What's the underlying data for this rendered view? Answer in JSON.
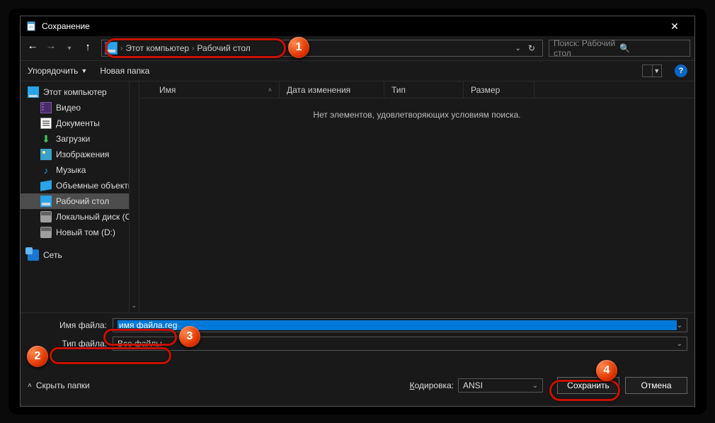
{
  "window": {
    "title": "Сохранение"
  },
  "nav": {
    "breadcrumb": [
      "Этот компьютер",
      "Рабочий стол"
    ],
    "search_placeholder": "Поиск: Рабочий стол"
  },
  "toolbar": {
    "organize": "Упорядочить",
    "new_folder": "Новая папка"
  },
  "columns": {
    "name": "Имя",
    "date": "Дата изменения",
    "type": "Тип",
    "size": "Размер"
  },
  "empty_text": "Нет элементов, удовлетворяющих условиям поиска.",
  "tree": {
    "this_pc": "Этот компьютер",
    "items": [
      {
        "icon": "video",
        "label": "Видео"
      },
      {
        "icon": "doc",
        "label": "Документы"
      },
      {
        "icon": "down",
        "label": "Загрузки"
      },
      {
        "icon": "img",
        "label": "Изображения"
      },
      {
        "icon": "music",
        "label": "Музыка"
      },
      {
        "icon": "obj",
        "label": "Объемные объекты"
      },
      {
        "icon": "desk",
        "label": "Рабочий стол",
        "selected": true
      },
      {
        "icon": "disk",
        "label": "Локальный диск (C:)"
      },
      {
        "icon": "disk",
        "label": "Новый том (D:)"
      }
    ],
    "network": "Сеть"
  },
  "fields": {
    "filename_label": "Имя файла:",
    "filename_value": "имя файла.reg",
    "filetype_label": "Тип файла:",
    "filetype_value": "Все файлы"
  },
  "footer": {
    "hide_folders": "Скрыть папки",
    "encoding_label": "Кодировка:",
    "encoding_value": "ANSI",
    "save": "Сохранить",
    "cancel": "Отмена"
  },
  "annotations": {
    "b1": "1",
    "b2": "2",
    "b3": "3",
    "b4": "4"
  }
}
